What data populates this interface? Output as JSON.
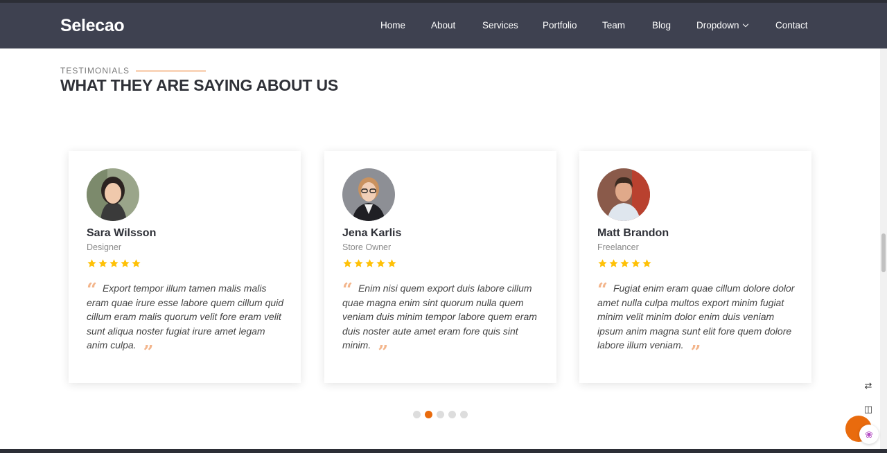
{
  "header": {
    "logo": "Selecao",
    "nav": [
      {
        "label": "Home"
      },
      {
        "label": "About"
      },
      {
        "label": "Services"
      },
      {
        "label": "Portfolio"
      },
      {
        "label": "Team"
      },
      {
        "label": "Blog"
      },
      {
        "label": "Dropdown"
      },
      {
        "label": "Contact"
      }
    ]
  },
  "section": {
    "subtitle": "TESTIMONIALS",
    "title": "WHAT THEY ARE SAYING ABOUT US"
  },
  "testimonials": [
    {
      "name": "Sara Wilsson",
      "role": "Designer",
      "rating": 5,
      "quote": "Export tempor illum tamen malis malis eram quae irure esse labore quem cillum quid cillum eram malis quorum velit fore eram velit sunt aliqua noster fugiat irure amet legam anim culpa."
    },
    {
      "name": "Jena Karlis",
      "role": "Store Owner",
      "rating": 5,
      "quote": "Enim nisi quem export duis labore cillum quae magna enim sint quorum nulla quem veniam duis minim tempor labore quem eram duis noster aute amet eram fore quis sint minim."
    },
    {
      "name": "Matt Brandon",
      "role": "Freelancer",
      "rating": 5,
      "quote": "Fugiat enim eram quae cillum dolore dolor amet nulla culpa multos export minim fugiat minim velit minim dolor enim duis veniam ipsum anim magna sunt elit fore quem dolore labore illum veniam."
    }
  ],
  "carousel": {
    "page_count": 5,
    "active_page": 2
  },
  "colors": {
    "accent": "#e96b0d",
    "header_bg": "#3e4150",
    "star": "#ffc107"
  }
}
